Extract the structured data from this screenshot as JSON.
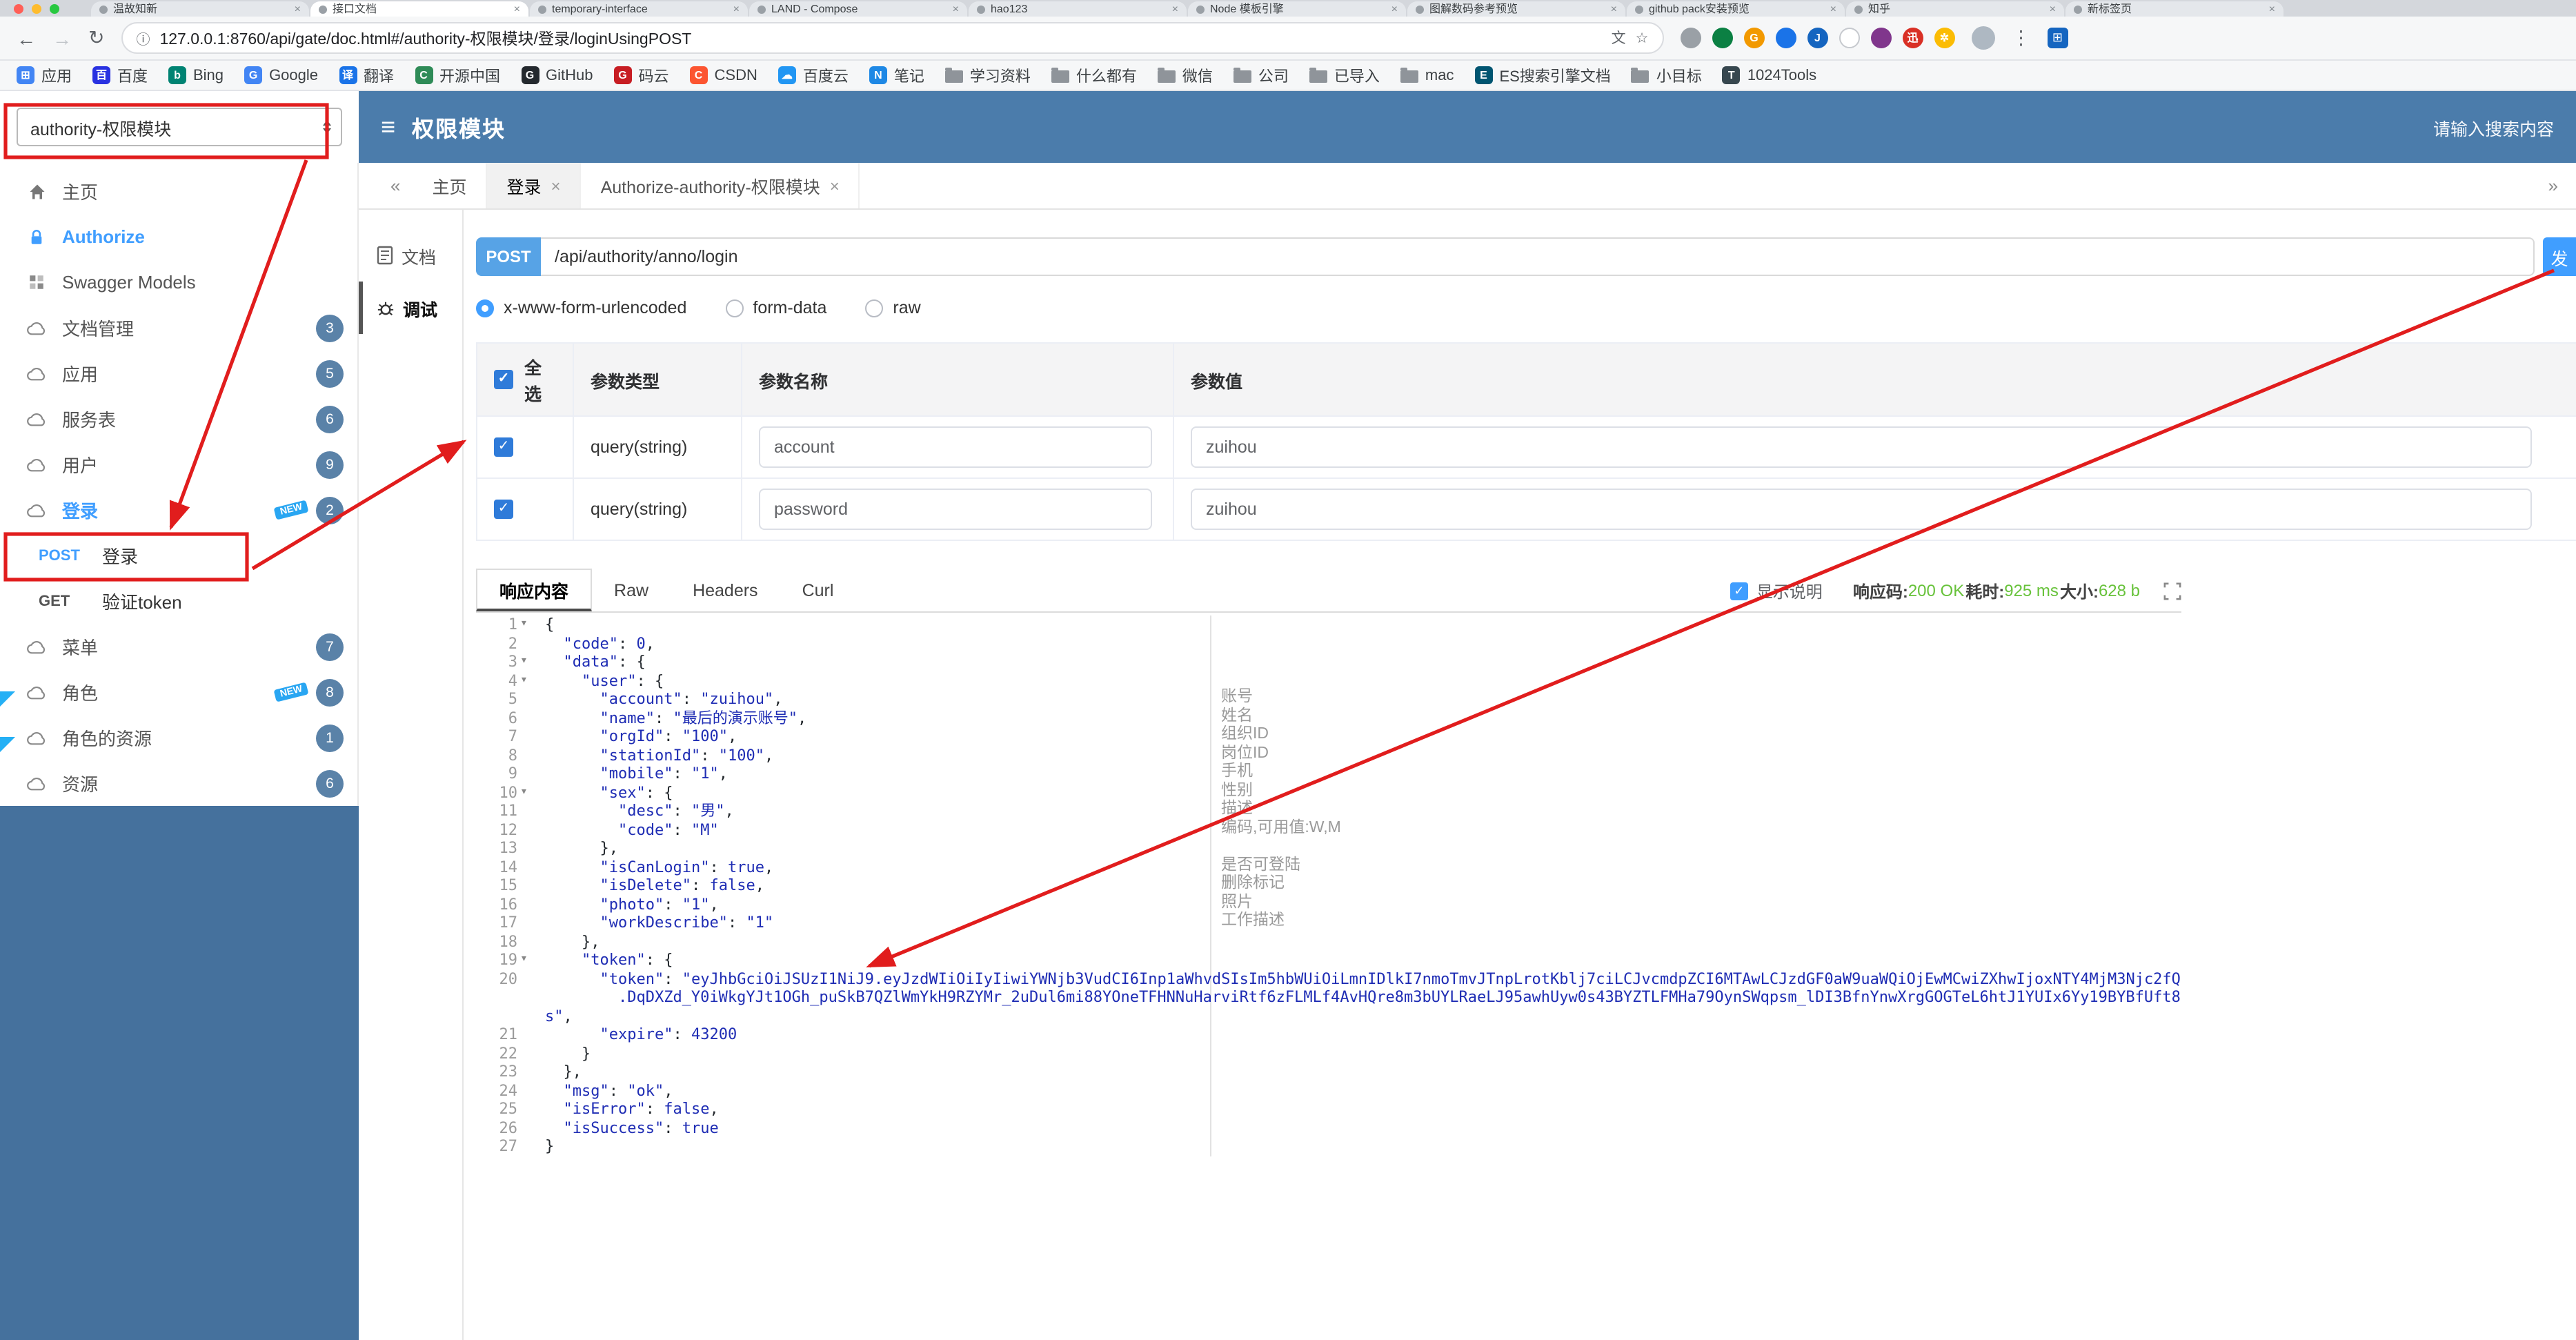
{
  "browser": {
    "tabs": [
      {
        "label": "温故知新",
        "active": false
      },
      {
        "label": "接口文档",
        "active": true
      },
      {
        "label": "temporary-interface",
        "active": false
      },
      {
        "label": "LAND - Compose",
        "active": false
      },
      {
        "label": "hao123",
        "active": false
      },
      {
        "label": "Node 模板引擎",
        "active": false
      },
      {
        "label": "图解数码参考预览",
        "active": false
      },
      {
        "label": "github pack安装预览",
        "active": false
      },
      {
        "label": "知乎",
        "active": false
      },
      {
        "label": "新标签页",
        "active": false
      }
    ],
    "toolbar": {
      "back_icon": "←",
      "forward_icon": "→",
      "reload_icon": "↻",
      "info_icon": "ⓘ",
      "url": "127.0.0.1:8760/api/gate/doc.html#/authority-权限模块/登录/loginUsingPOST",
      "translate_icon": "文",
      "star_icon": "☆",
      "menu_icon": "⋮",
      "extensions": [
        {
          "letter": "",
          "color": "#9aa0a6"
        },
        {
          "letter": "",
          "color": "#0b8043"
        },
        {
          "letter": "G",
          "color": "#f29900"
        },
        {
          "letter": "",
          "color": "#1a73e8"
        },
        {
          "letter": "J",
          "color": "#1565c0"
        },
        {
          "letter": "",
          "color": "#ffffff"
        },
        {
          "letter": "",
          "color": "#80368c"
        },
        {
          "letter": "迅",
          "color": "#d93025"
        },
        {
          "letter": "✲",
          "color": "#fbbc04"
        }
      ]
    },
    "bookmarks": [
      {
        "label": "应用",
        "kind": "site",
        "letter": "⊞",
        "color": "#4285f4"
      },
      {
        "label": "百度",
        "kind": "site",
        "letter": "百",
        "color": "#2932e1"
      },
      {
        "label": "Bing",
        "kind": "site",
        "letter": "b",
        "color": "#008373"
      },
      {
        "label": "Google",
        "kind": "site",
        "letter": "G",
        "color": "#4285f4"
      },
      {
        "label": "翻译",
        "kind": "site",
        "letter": "译",
        "color": "#1a73e8"
      },
      {
        "label": "开源中国",
        "kind": "site",
        "letter": "C",
        "color": "#2e8b57"
      },
      {
        "label": "GitHub",
        "kind": "site",
        "letter": "G",
        "color": "#24292e"
      },
      {
        "label": "码云",
        "kind": "site",
        "letter": "G",
        "color": "#c71d23"
      },
      {
        "label": "CSDN",
        "kind": "site",
        "letter": "C",
        "color": "#fc5531"
      },
      {
        "label": "百度云",
        "kind": "site",
        "letter": "☁",
        "color": "#2196f3"
      },
      {
        "label": "笔记",
        "kind": "site",
        "letter": "N",
        "color": "#1e88e5"
      },
      {
        "label": "学习资料",
        "kind": "folder"
      },
      {
        "label": "什么都有",
        "kind": "folder"
      },
      {
        "label": "微信",
        "kind": "folder"
      },
      {
        "label": "公司",
        "kind": "folder"
      },
      {
        "label": "已导入",
        "kind": "folder"
      },
      {
        "label": "mac",
        "kind": "folder"
      },
      {
        "label": "ES搜索引擎文档",
        "kind": "site",
        "letter": "E",
        "color": "#005571"
      },
      {
        "label": "小目标",
        "kind": "folder"
      },
      {
        "label": "1024Tools",
        "kind": "site",
        "letter": "T",
        "color": "#37474f"
      }
    ]
  },
  "header": {
    "group_select": "authority-权限模块",
    "menu_icon": "≡",
    "title": "权限模块",
    "search_placeholder": "请输入搜索内容"
  },
  "sidebar": {
    "items": [
      {
        "type": "nav",
        "icon": "home",
        "label": "主页"
      },
      {
        "type": "nav",
        "icon": "lock",
        "label": "Authorize",
        "accent": true
      },
      {
        "type": "nav",
        "icon": "models",
        "label": "Swagger Models"
      },
      {
        "type": "nav",
        "icon": "cloud",
        "label": "文档管理",
        "badge": "3"
      },
      {
        "type": "nav",
        "icon": "cloud",
        "label": "应用",
        "badge": "5"
      },
      {
        "type": "nav",
        "icon": "cloud",
        "label": "服务表",
        "badge": "6"
      },
      {
        "type": "nav",
        "icon": "cloud",
        "label": "用户",
        "badge": "9"
      },
      {
        "type": "nav",
        "icon": "cloud",
        "label": "登录",
        "badge": "2",
        "new": true,
        "accent": true
      },
      {
        "type": "op",
        "method": "POST",
        "label": "登录",
        "active": true
      },
      {
        "type": "op",
        "method": "GET",
        "label": "验证token"
      },
      {
        "type": "nav",
        "icon": "cloud",
        "label": "菜单",
        "badge": "7"
      },
      {
        "type": "nav",
        "icon": "cloud",
        "label": "角色",
        "badge": "8",
        "new": true
      },
      {
        "type": "nav",
        "icon": "cloud",
        "label": "角色的资源",
        "badge": "1"
      },
      {
        "type": "nav",
        "icon": "cloud",
        "label": "资源",
        "badge": "6"
      }
    ]
  },
  "doc_tabs": {
    "scroll_left": "«",
    "scroll_right": "»",
    "items": [
      {
        "label": "主页",
        "closable": false,
        "active": false
      },
      {
        "label": "登录",
        "closable": true,
        "active": true
      },
      {
        "label": "Authorize-authority-权限模块",
        "closable": true,
        "active": false
      }
    ]
  },
  "doc_nav": {
    "items": [
      {
        "label": "文档",
        "active": false
      },
      {
        "label": "调试",
        "active": true
      }
    ]
  },
  "request": {
    "method": "POST",
    "url": "/api/authority/anno/login",
    "send_label": "发",
    "content_types": {
      "options": [
        "x-www-form-urlencoded",
        "form-data",
        "raw"
      ],
      "selected": "x-www-form-urlencoded"
    }
  },
  "params": {
    "select_all_label": "全选",
    "columns": [
      "参数类型",
      "参数名称",
      "参数值"
    ],
    "rows": [
      {
        "checked": true,
        "type": "query(string)",
        "name": "account",
        "value": "zuihou"
      },
      {
        "checked": true,
        "type": "query(string)",
        "name": "password",
        "value": "zuihou"
      }
    ]
  },
  "response": {
    "tabs": [
      "响应内容",
      "Raw",
      "Headers",
      "Curl"
    ],
    "active_tab": "响应内容",
    "show_desc_label": "显示说明",
    "show_desc_checked": true,
    "meta": [
      {
        "label": "响应码:",
        "value": "200 OK"
      },
      {
        "label": "耗时:",
        "value": "925 ms"
      },
      {
        "label": "大小:",
        "value": "628 b"
      }
    ]
  },
  "editor": {
    "fold_lines": [
      1,
      3,
      4,
      10,
      19
    ],
    "lines": [
      "{",
      "  \"code\": 0,",
      "  \"data\": {",
      "    \"user\": {",
      "      \"account\": \"zuihou\",",
      "      \"name\": \"最后的演示账号\",",
      "      \"orgId\": \"100\",",
      "      \"stationId\": \"100\",",
      "      \"mobile\": \"1\",",
      "      \"sex\": {",
      "        \"desc\": \"男\",",
      "        \"code\": \"M\"",
      "      },",
      "      \"isCanLogin\": true,",
      "      \"isDelete\": false,",
      "      \"photo\": \"1\",",
      "      \"workDescribe\": \"1\"",
      "    },",
      "    \"token\": {",
      "      \"token\": \"eyJhbGciOiJSUzI1NiJ9.eyJzdWIiOiIyIiwiYWNjb3VudCI6Inp1aWhvdSIsIm5hbWUiOiLmnIDlkI7nmoTmvJTnpLrotKblj7ciLCJvcmdpZCI6MTAwLCJzdGF0aW9uaWQiOjEwMCwiZXhwIjoxNTY4MjM3Njc2fQ\n        .DqDXZd_Y0iWkgYJt1OGh_puSkB7QZlWmYkH9RZYMr_2uDul6mi88YOneTFHNNuHarviRtf6zFLMLf4AvHQre8m3bUYLRaeLJ95awhUyw0s43BYZTLFMHa79OynSWqpsm_lDI3BfnYnwXrgGOGTeL6htJ1YUIx6Yy19BYBfUft8s\",",
      "      \"expire\": 43200",
      "    }",
      "  },",
      "  \"msg\": \"ok\",",
      "  \"isError\": false,",
      "  \"isSuccess\": true",
      "}"
    ],
    "annotations": [
      {
        "line": 5,
        "text": "账号"
      },
      {
        "line": 6,
        "text": "姓名"
      },
      {
        "line": 7,
        "text": "组织ID"
      },
      {
        "line": 8,
        "text": "岗位ID"
      },
      {
        "line": 9,
        "text": "手机"
      },
      {
        "line": 10,
        "text": "性别"
      },
      {
        "line": 11,
        "text": "描述"
      },
      {
        "line": 12,
        "text": "编码,可用值:W,M"
      },
      {
        "line": 14,
        "text": "是否可登陆"
      },
      {
        "line": 15,
        "text": "删除标记"
      },
      {
        "line": 16,
        "text": "照片"
      },
      {
        "line": 17,
        "text": "工作描述"
      }
    ]
  }
}
